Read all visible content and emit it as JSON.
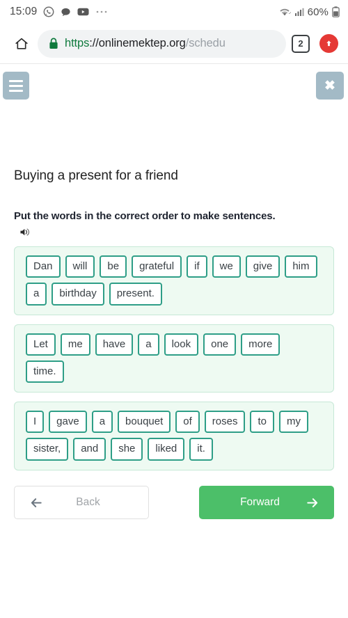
{
  "status_bar": {
    "clock": "15:09",
    "battery_percent": "60%",
    "icons": [
      "whatsapp-icon",
      "messages-icon",
      "youtube-icon",
      "more-dots-icon"
    ],
    "right_icons": [
      "wifi-icon",
      "signal-icon",
      "battery-icon"
    ]
  },
  "browser": {
    "home_icon": "home-icon",
    "lock_icon": "lock-icon",
    "url_scheme": "https",
    "url_host": "://onlinemektep.org",
    "url_path": "/schedu",
    "url_full": "https://onlinemektep.org/schedu",
    "tab_count": "2",
    "profile_icon": "profile-avatar-icon"
  },
  "page": {
    "menu_label": "menu",
    "close_label": "✖",
    "lesson_title": "Buying a present for a friend",
    "instruction": "Put the words in the correct order to make sentences.",
    "speaker_icon": "speaker-icon"
  },
  "sentences": [
    {
      "id": "sentence-1",
      "full_text": "Dan will be grateful if we give him a birthday present.",
      "words": [
        "Dan",
        "will",
        "be",
        "grateful",
        "if",
        "we",
        "give",
        "him",
        "a",
        "birthday",
        "present."
      ]
    },
    {
      "id": "sentence-2",
      "full_text": "Let me have a look one more time.",
      "words": [
        "Let",
        "me",
        "have",
        "a",
        "look",
        "one",
        "more",
        "time."
      ]
    },
    {
      "id": "sentence-3",
      "full_text": "I gave a bouquet of roses to my sister, and she liked it.",
      "words": [
        "I",
        "gave",
        "a",
        "bouquet",
        "of",
        "roses",
        "to",
        "my",
        "sister,",
        "and",
        "she",
        "liked",
        "it."
      ]
    }
  ],
  "navigation": {
    "back_label": "Back",
    "forward_label": "Forward",
    "back_icon": "arrow-left-icon",
    "forward_icon": "arrow-right-icon"
  },
  "colors": {
    "accent_green": "#4cbf69",
    "chip_border": "#2e9e87",
    "box_background": "#eefaf2",
    "box_border": "#c6e8d6",
    "header_button": "#a3bac6",
    "url_scheme_green": "#0f7a3d",
    "profile_red": "#e53935"
  }
}
